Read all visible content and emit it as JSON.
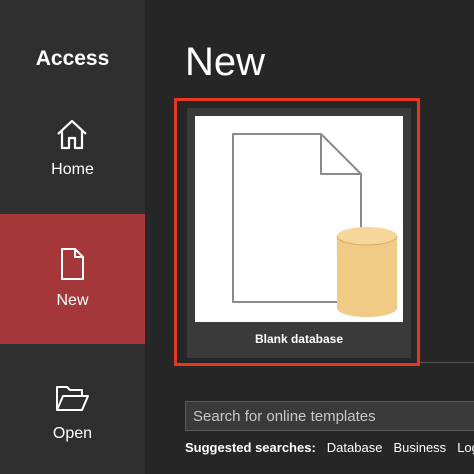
{
  "app": {
    "title": "Access"
  },
  "sidebar": {
    "items": [
      {
        "label": "Home",
        "icon": "home-icon"
      },
      {
        "label": "New",
        "icon": "new-document-icon",
        "selected": true
      },
      {
        "label": "Open",
        "icon": "folder-open-icon"
      }
    ]
  },
  "main": {
    "title": "New",
    "templates": [
      {
        "label": "Blank database",
        "icon": "blank-database-thumbnail"
      }
    ],
    "search": {
      "placeholder": "Search for online templates",
      "value": ""
    },
    "suggested": {
      "label": "Suggested searches:",
      "links": [
        "Database",
        "Business",
        "Logs"
      ]
    }
  },
  "colors": {
    "sidebar_bg": "#2f2f2f",
    "selected_bg": "#a4373a",
    "main_bg": "#262626",
    "highlight_border": "#e8371f",
    "database_fill": "#f0cb85"
  }
}
